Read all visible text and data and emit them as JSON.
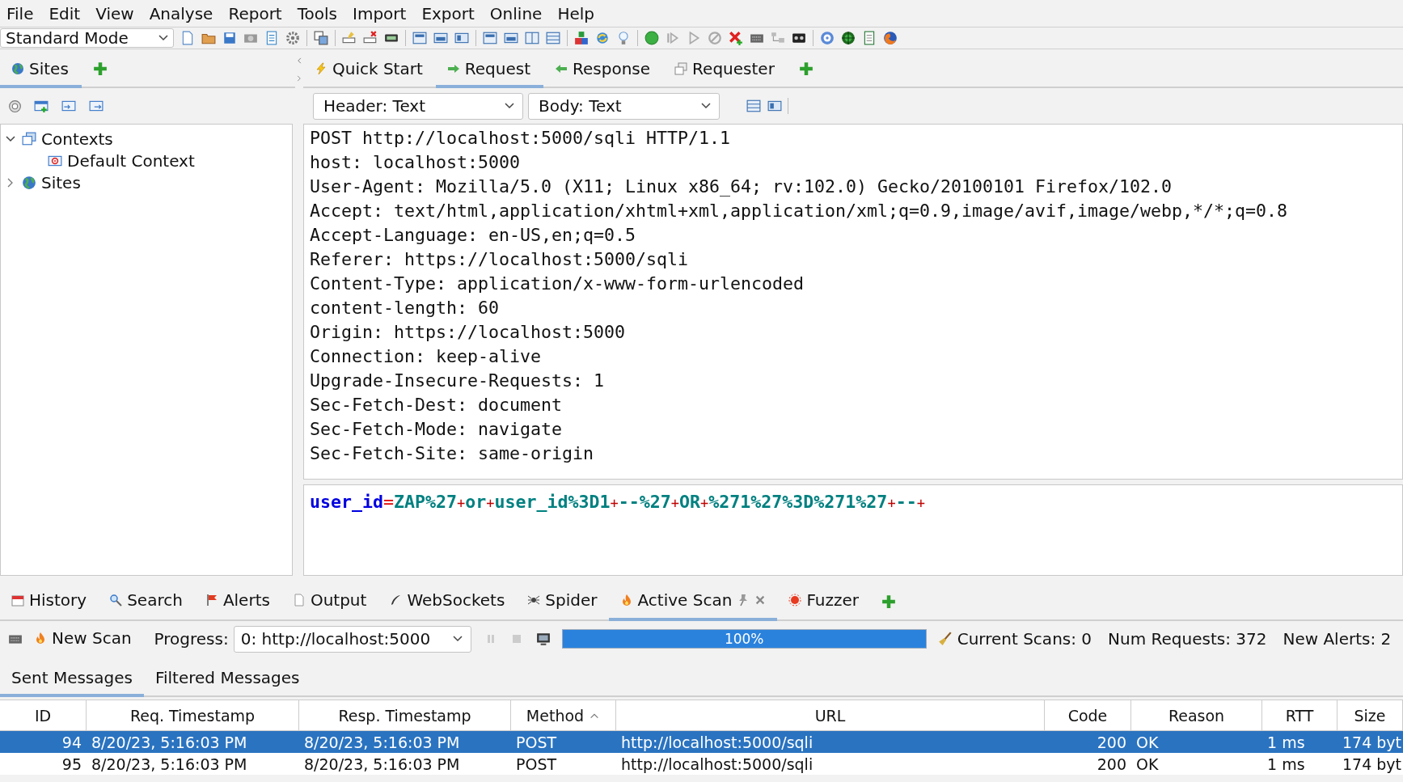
{
  "menu": [
    "File",
    "Edit",
    "View",
    "Analyse",
    "Report",
    "Tools",
    "Import",
    "Export",
    "Online",
    "Help"
  ],
  "mode_select": {
    "value": "Standard Mode"
  },
  "left_tabs": [
    {
      "label": "Sites",
      "selected": true
    }
  ],
  "tree": [
    {
      "label": "Contexts",
      "expanded": true,
      "children": [
        {
          "label": "Default Context"
        }
      ]
    },
    {
      "label": "Sites",
      "expanded": false
    }
  ],
  "main_tabs": [
    {
      "label": "Quick Start",
      "selected": false
    },
    {
      "label": "Request",
      "selected": true
    },
    {
      "label": "Response",
      "selected": false
    },
    {
      "label": "Requester",
      "selected": false
    }
  ],
  "header_view": {
    "value": "Header: Text"
  },
  "body_view": {
    "value": "Body: Text"
  },
  "header_lines": [
    "POST http://localhost:5000/sqli HTTP/1.1",
    "host: localhost:5000",
    "User-Agent: Mozilla/5.0 (X11; Linux x86_64; rv:102.0) Gecko/20100101 Firefox/102.0",
    "Accept: text/html,application/xhtml+xml,application/xml;q=0.9,image/avif,image/webp,*/*;q=0.8",
    "Accept-Language: en-US,en;q=0.5",
    "Referer: https://localhost:5000/sqli",
    "Content-Type: application/x-www-form-urlencoded",
    "content-length: 60",
    "Origin: https://localhost:5000",
    "Connection: keep-alive",
    "Upgrade-Insecure-Requests: 1",
    "Sec-Fetch-Dest: document",
    "Sec-Fetch-Mode: navigate",
    "Sec-Fetch-Site: same-origin"
  ],
  "body_tokens": [
    {
      "kind": "key",
      "text": "user_id"
    },
    {
      "kind": "equals",
      "text": "="
    },
    {
      "kind": "value",
      "text": "ZAP%27"
    },
    {
      "kind": "plus",
      "text": "+"
    },
    {
      "kind": "value",
      "text": "or"
    },
    {
      "kind": "plus",
      "text": "+"
    },
    {
      "kind": "value",
      "text": "user_id%3D1"
    },
    {
      "kind": "plus",
      "text": "+"
    },
    {
      "kind": "value",
      "text": "--%27"
    },
    {
      "kind": "plus",
      "text": "+"
    },
    {
      "kind": "value",
      "text": "OR"
    },
    {
      "kind": "plus",
      "text": "+"
    },
    {
      "kind": "value",
      "text": "%271%27%3D%271%27"
    },
    {
      "kind": "plus",
      "text": "+"
    },
    {
      "kind": "value",
      "text": "--"
    },
    {
      "kind": "plus",
      "text": "+"
    }
  ],
  "bottom_tabs": [
    {
      "label": "History",
      "selected": false
    },
    {
      "label": "Search",
      "selected": false
    },
    {
      "label": "Alerts",
      "selected": false
    },
    {
      "label": "Output",
      "selected": false
    },
    {
      "label": "WebSockets",
      "selected": false
    },
    {
      "label": "Spider",
      "selected": false
    },
    {
      "label": "Active Scan",
      "selected": true
    },
    {
      "label": "Fuzzer",
      "selected": false
    }
  ],
  "scan_bar": {
    "new_scan": "New Scan",
    "progress_label": "Progress:",
    "target": "0: http://localhost:5000",
    "progress": {
      "level": 1,
      "reading": "100%"
    },
    "current_scans": "Current Scans: 0",
    "num_requests": "Num Requests: 372",
    "new_alerts": "New Alerts: 2"
  },
  "sub_tabs": [
    {
      "label": "Sent Messages",
      "selected": true
    },
    {
      "label": "Filtered Messages",
      "selected": false
    }
  ],
  "table": {
    "columns": [
      {
        "label": "ID",
        "sorted": false
      },
      {
        "label": "Req. Timestamp",
        "sorted": false
      },
      {
        "label": "Resp. Timestamp",
        "sorted": false
      },
      {
        "label": "Method",
        "sorted": true
      },
      {
        "label": "URL",
        "sorted": false
      },
      {
        "label": "Code",
        "sorted": false
      },
      {
        "label": "Reason",
        "sorted": false
      },
      {
        "label": "RTT",
        "sorted": false
      },
      {
        "label": "Size",
        "sorted": false
      }
    ],
    "rows": [
      {
        "selected": true,
        "cells": [
          "94",
          "8/20/23, 5:16:03 PM",
          "8/20/23, 5:16:03 PM",
          "POST",
          "http://localhost:5000/sqli",
          "200",
          "OK",
          "1 ms",
          "174 byt"
        ]
      },
      {
        "selected": false,
        "cells": [
          "95",
          "8/20/23, 5:16:03 PM",
          "8/20/23, 5:16:03 PM",
          "POST",
          "http://localhost:5000/sqli",
          "200",
          "OK",
          "1 ms",
          "174 byt"
        ]
      }
    ]
  }
}
